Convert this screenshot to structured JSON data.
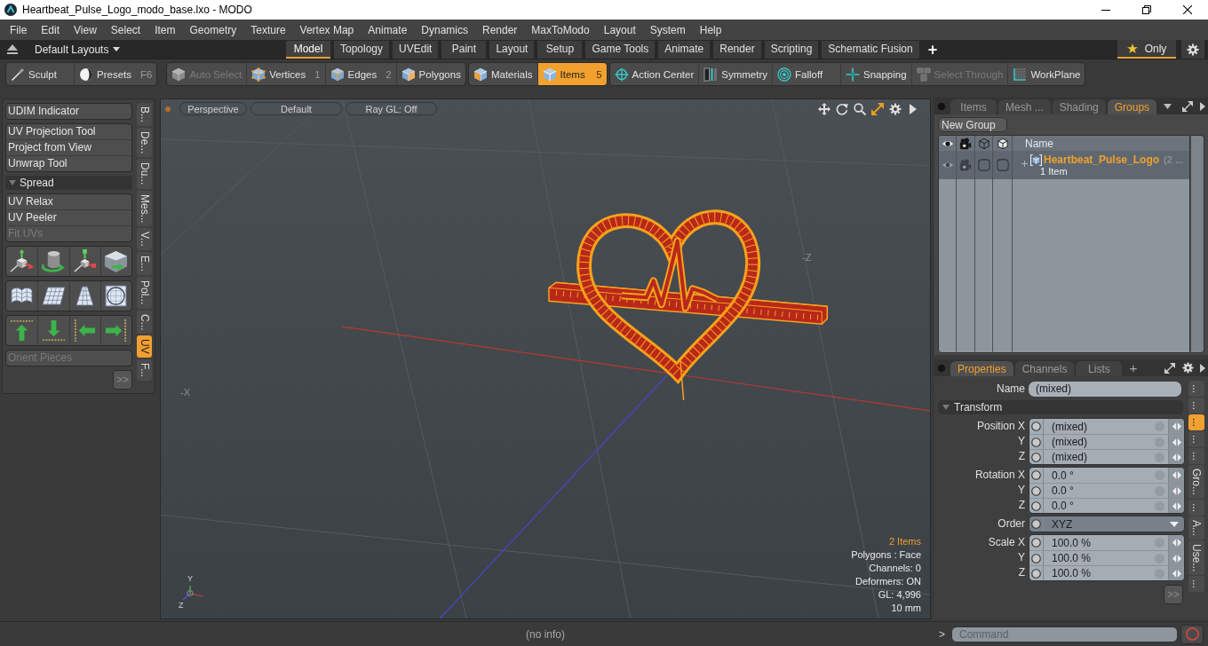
{
  "window": {
    "title": "Heartbeat_Pulse_Logo_modo_base.lxo - MODO"
  },
  "menu": [
    "File",
    "Edit",
    "View",
    "Select",
    "Item",
    "Geometry",
    "Texture",
    "Vertex Map",
    "Animate",
    "Dynamics",
    "Render",
    "MaxToModo",
    "Layout",
    "System",
    "Help"
  ],
  "layout_bar": {
    "layouts": "Default Layouts",
    "tabs": [
      {
        "label": "Model",
        "selected": true
      },
      {
        "label": "Topology",
        "selected": false
      },
      {
        "label": "UVEdit",
        "selected": false
      },
      {
        "label": "Paint",
        "selected": false
      },
      {
        "label": "Layout",
        "selected": false
      },
      {
        "label": "Setup",
        "selected": false
      },
      {
        "label": "Game Tools",
        "selected": false
      },
      {
        "label": "Animate",
        "selected": false
      },
      {
        "label": "Render",
        "selected": false
      },
      {
        "label": "Scripting",
        "selected": false
      },
      {
        "label": "Schematic Fusion",
        "selected": false
      }
    ],
    "add_tab": "+",
    "only": {
      "label": "Only",
      "on": true
    }
  },
  "toolbar": {
    "groups": [
      {
        "buttons": [
          {
            "label": "Sculpt",
            "selected": false,
            "disabled": false
          },
          {
            "label": "Presets",
            "shortcut": "F6",
            "selected": false,
            "disabled": false
          }
        ]
      },
      {
        "buttons": [
          {
            "label": "Auto Select",
            "selected": false,
            "disabled": true
          },
          {
            "label": "Vertices",
            "shortcut": "1",
            "selected": false,
            "disabled": false
          },
          {
            "label": "Edges",
            "shortcut": "2",
            "selected": false,
            "disabled": false
          },
          {
            "label": "Polygons",
            "selected": false,
            "disabled": false
          }
        ]
      },
      {
        "buttons": [
          {
            "label": "Materials",
            "selected": false,
            "disabled": false
          },
          {
            "label": "Items",
            "shortcut": "5",
            "selected": true,
            "disabled": false
          }
        ]
      },
      {
        "buttons": [
          {
            "label": "Action Center",
            "selected": false,
            "disabled": false
          },
          {
            "label": "Symmetry",
            "selected": false,
            "disabled": false
          },
          {
            "label": "Falloff",
            "selected": false,
            "disabled": false
          },
          {
            "label": "Snapping",
            "selected": false,
            "disabled": false
          },
          {
            "label": "Select Through",
            "selected": false,
            "disabled": true
          },
          {
            "label": "WorkPlane",
            "selected": false,
            "disabled": false
          }
        ]
      }
    ]
  },
  "left_panel": {
    "items": [
      {
        "kind": "buttons",
        "buttons": [
          {
            "label": "UDIM Indicator",
            "disabled": false
          }
        ]
      },
      {
        "kind": "buttons",
        "buttons": [
          {
            "label": "UV Projection Tool",
            "disabled": false
          },
          {
            "label": "Project from View",
            "disabled": false
          },
          {
            "label": "Unwrap Tool",
            "disabled": false
          }
        ]
      },
      {
        "kind": "header",
        "label": "Spread",
        "expanded": true
      },
      {
        "kind": "buttons",
        "buttons": [
          {
            "label": "UV Relax",
            "disabled": false
          },
          {
            "label": "UV Peeler",
            "disabled": false
          },
          {
            "label": "Fit UVs",
            "disabled": true
          }
        ]
      },
      {
        "kind": "icon_row"
      },
      {
        "kind": "icon_row"
      },
      {
        "kind": "icon_row"
      },
      {
        "kind": "buttons",
        "buttons": [
          {
            "label": "Orient Pieces",
            "disabled": true
          }
        ]
      },
      {
        "kind": "more",
        "label": ">>"
      }
    ],
    "side_tabs": [
      {
        "label": "B...",
        "selected": false
      },
      {
        "label": "De...",
        "selected": false
      },
      {
        "label": "Du...",
        "selected": false
      },
      {
        "label": "Mes...",
        "selected": false
      },
      {
        "label": "V...",
        "selected": false
      },
      {
        "label": "E...",
        "selected": false
      },
      {
        "label": "Pol...",
        "selected": false
      },
      {
        "label": "C...",
        "selected": false
      },
      {
        "label": "UV",
        "selected": true
      },
      {
        "label": "F...",
        "selected": false
      }
    ]
  },
  "viewport": {
    "header_buttons": [
      "Perspective",
      "Default",
      "Ray GL: Off"
    ],
    "axis_labels": [
      "-Z",
      "-X"
    ],
    "gizmo_labels": [
      "Y",
      "Z"
    ],
    "info": [
      {
        "text": "2 Items",
        "highlight": true
      },
      {
        "text": "Polygons : Face",
        "highlight": false
      },
      {
        "text": "Channels: 0",
        "highlight": false
      },
      {
        "text": "Deformers: ON",
        "highlight": false
      },
      {
        "text": "GL: 4,996",
        "highlight": false
      },
      {
        "text": "10 mm",
        "highlight": false
      }
    ]
  },
  "groups_panel": {
    "tabs": [
      {
        "label": "Items",
        "selected": false
      },
      {
        "label": "Mesh ...",
        "selected": false
      },
      {
        "label": "Shading",
        "selected": false
      },
      {
        "label": "Groups",
        "selected": true
      }
    ],
    "new_button": "New Group",
    "columns": [
      {
        "kind": "eye"
      },
      {
        "kind": "camera"
      },
      {
        "kind": "wire_cube"
      },
      {
        "kind": "solid_cube"
      },
      {
        "kind": "text",
        "label": "Name"
      }
    ],
    "rows": [
      {
        "name": "Heartbeat_Pulse_Logo",
        "count": "(2 ...",
        "detail": "1 Item",
        "expanded": false,
        "cells": [
          {
            "checked": true
          },
          {
            "checked": true
          },
          {
            "checked": false
          },
          {
            "checked": false
          }
        ]
      }
    ]
  },
  "properties": {
    "tabs": [
      {
        "label": "Properties",
        "selected": true
      },
      {
        "label": "Channels",
        "selected": false
      },
      {
        "label": "Lists",
        "selected": false
      }
    ],
    "add_tab": "+",
    "name": {
      "label": "Name",
      "value": "(mixed)"
    },
    "section": {
      "label": "Transform",
      "expanded": true
    },
    "groups": [
      {
        "kind": "fields",
        "rows": [
          {
            "label": "Position X",
            "value": "(mixed)"
          },
          {
            "label": "Y",
            "value": "(mixed)"
          },
          {
            "label": "Z",
            "value": "(mixed)"
          }
        ]
      },
      {
        "kind": "fields",
        "rows": [
          {
            "label": "Rotation X",
            "value": "0.0 °"
          },
          {
            "label": "Y",
            "value": "0.0 °"
          },
          {
            "label": "Z",
            "value": "0.0 °"
          }
        ]
      },
      {
        "kind": "dropdown",
        "rows": [
          {
            "label": "Order",
            "value": "XYZ"
          }
        ]
      },
      {
        "kind": "fields",
        "rows": [
          {
            "label": "Scale X",
            "value": "100.0 %"
          },
          {
            "label": "Y",
            "value": "100.0 %"
          },
          {
            "label": "Z",
            "value": "100.0 %"
          }
        ]
      }
    ],
    "more": ">>",
    "side_tabs": [
      {
        "label": "...",
        "selected": false
      },
      {
        "label": "...",
        "selected": false
      },
      {
        "label": "...",
        "selected": true
      },
      {
        "label": "...",
        "selected": false
      },
      {
        "label": "...",
        "selected": false
      },
      {
        "label": "Gro...",
        "selected": false
      },
      {
        "label": "...",
        "selected": false
      },
      {
        "label": "A...",
        "selected": false
      },
      {
        "label": "Use...",
        "selected": false
      },
      {
        "label": "...",
        "selected": false
      }
    ]
  },
  "status_bar": {
    "status": "(no info)",
    "prompt": ">",
    "command_placeholder": "Command"
  }
}
